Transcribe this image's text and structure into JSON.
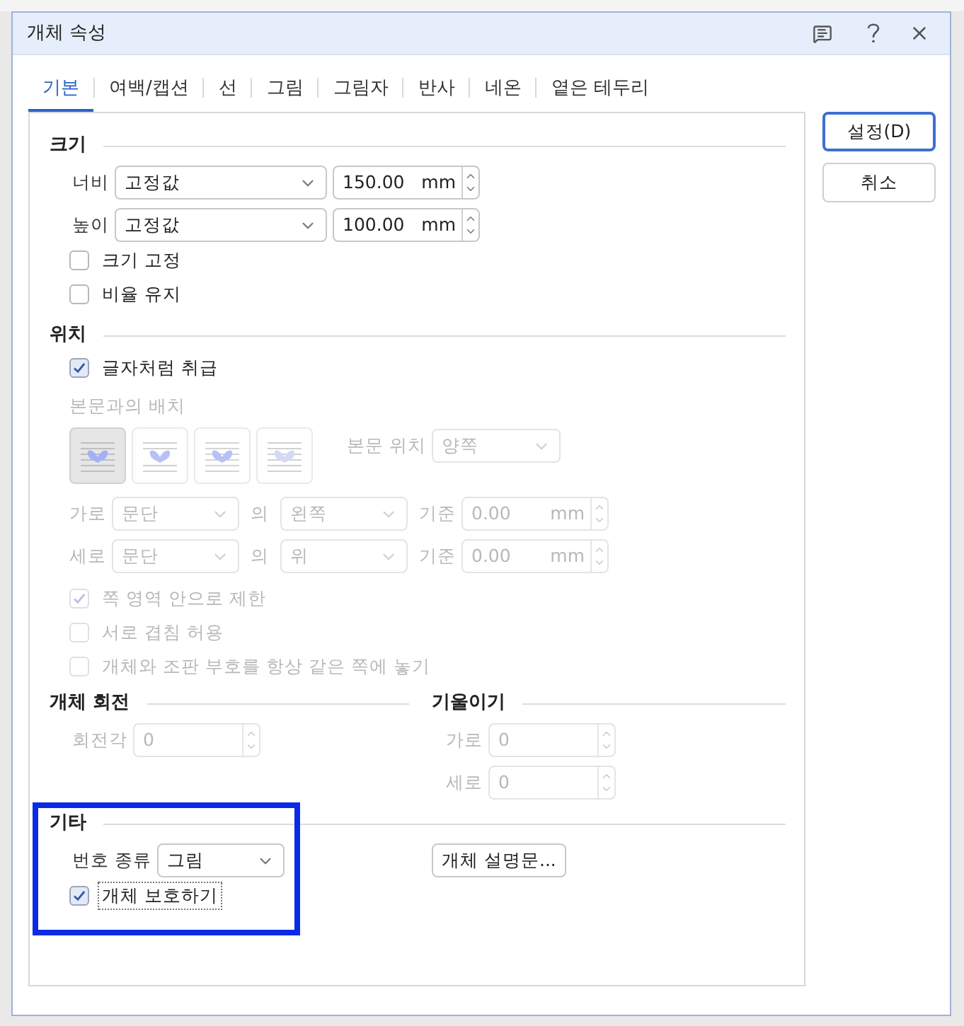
{
  "window": {
    "title": "개체 속성"
  },
  "tabs": [
    {
      "label": "기본",
      "selected": true
    },
    {
      "label": "여백/캡션",
      "selected": false
    },
    {
      "label": "선",
      "selected": false
    },
    {
      "label": "그림",
      "selected": false
    },
    {
      "label": "그림자",
      "selected": false
    },
    {
      "label": "반사",
      "selected": false
    },
    {
      "label": "네온",
      "selected": false
    },
    {
      "label": "옅은 테두리",
      "selected": false
    }
  ],
  "buttons": [
    {
      "label": "설정(D)",
      "default": true
    },
    {
      "label": "취소",
      "default": false
    }
  ],
  "size": {
    "title": "크기",
    "rows": [
      {
        "label": "너비",
        "mode": "고정값",
        "value": "150.00",
        "unit": "mm"
      },
      {
        "label": "높이",
        "mode": "고정값",
        "value": "100.00",
        "unit": "mm"
      }
    ],
    "checks": [
      {
        "label": "크기 고정",
        "checked": false,
        "disabled": false
      },
      {
        "label": "비율 유지",
        "checked": false,
        "disabled": false
      }
    ]
  },
  "position": {
    "title": "위치",
    "treat_as_char": {
      "label": "글자처럼 취급",
      "checked": true,
      "disabled": false
    },
    "wrap_label": "본문과의 배치",
    "disabled": true,
    "wrap_options": [
      {
        "kind": "square",
        "selected": true
      },
      {
        "kind": "topbottom",
        "selected": false
      },
      {
        "kind": "front",
        "selected": false
      },
      {
        "kind": "behind",
        "selected": false
      }
    ],
    "text_position": {
      "label": "본문 위치",
      "value": "양쪽"
    },
    "rows": [
      {
        "label": "가로",
        "relative": "문단",
        "of": "의",
        "align": "왼쪽",
        "base": "기준",
        "value": "0.00",
        "unit": "mm"
      },
      {
        "label": "세로",
        "relative": "문단",
        "of": "의",
        "align": "위",
        "base": "기준",
        "value": "0.00",
        "unit": "mm"
      }
    ],
    "checks": [
      {
        "label": "쪽 영역 안으로 제한",
        "checked": true,
        "disabled": true
      },
      {
        "label": "서로 겹침 허용",
        "checked": false,
        "disabled": true
      },
      {
        "label": "개체와 조판 부호를 항상 같은 쪽에 놓기",
        "checked": false,
        "disabled": true
      }
    ]
  },
  "rotation": {
    "title": "개체 회전",
    "label": "회전각",
    "value": "0",
    "disabled": true
  },
  "skew": {
    "title": "기울이기",
    "disabled": true,
    "rows": [
      {
        "label": "가로",
        "value": "0"
      },
      {
        "label": "세로",
        "value": "0"
      }
    ]
  },
  "other": {
    "title": "기타",
    "number_label": "번호 종류",
    "number_type": "그림",
    "protect": {
      "label": "개체 보호하기",
      "checked": true,
      "disabled": false,
      "focused": true
    },
    "description_button": "개체 설명문..."
  }
}
